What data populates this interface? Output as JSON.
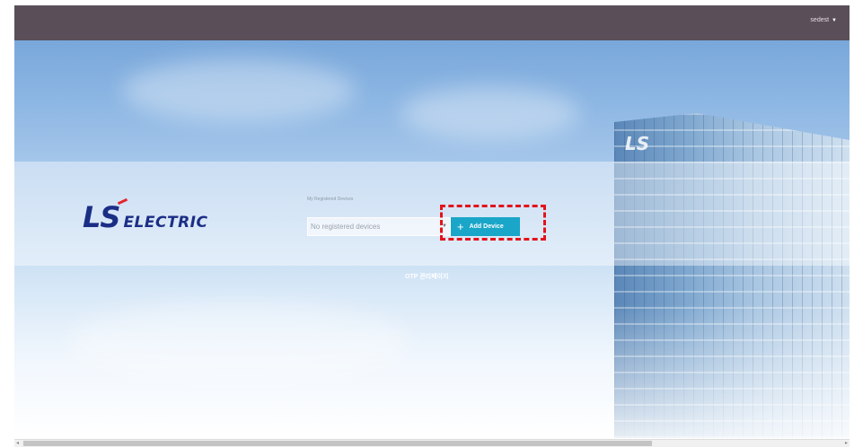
{
  "header": {
    "user_name": "sedest",
    "user_caret": "▼"
  },
  "brand": {
    "ls": "LS",
    "word": "ELECTRIC",
    "building_logo": "LS",
    "colors": {
      "navy": "#1b2e86",
      "red": "#e6242a"
    }
  },
  "devices": {
    "label": "My Registered Devices",
    "select_value": "No registered devices",
    "select_caret": "▼",
    "add_plus": "+",
    "add_label": "Add Device",
    "button_color": "#1aa6c8"
  },
  "footer_link": "OTP 관리페이지",
  "scrollbar": {
    "left_arrow": "◂",
    "right_arrow": "▸"
  }
}
